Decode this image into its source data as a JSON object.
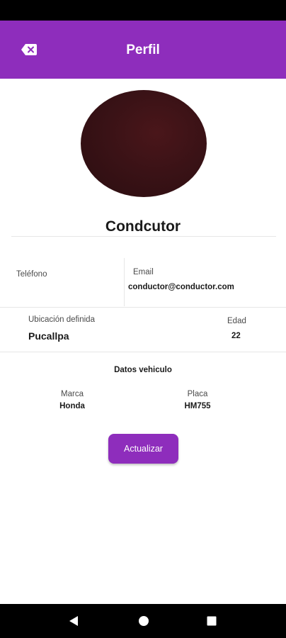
{
  "app_bar": {
    "title": "Perfil",
    "back_icon": "backspace-icon",
    "color": "#8e2dbc"
  },
  "profile": {
    "name": "Condcutor",
    "avatar": "profile-photo"
  },
  "contact": {
    "phone_label": "Teléfono",
    "phone_value": "",
    "email_label": "Email",
    "email_value": "conductor@conductor.com"
  },
  "location": {
    "label": "Ubicación definida",
    "value": "Pucallpa"
  },
  "age": {
    "label": "Edad",
    "value": "22"
  },
  "vehicle": {
    "title": "Datos vehiculo",
    "brand_label": "Marca",
    "brand_value": "Honda",
    "plate_label": "Placa",
    "plate_value": "HM755"
  },
  "actions": {
    "update_label": "Actualizar"
  },
  "nav": {
    "back_icon": "nav-back-icon",
    "home_icon": "nav-home-icon",
    "recents_icon": "nav-recents-icon"
  }
}
